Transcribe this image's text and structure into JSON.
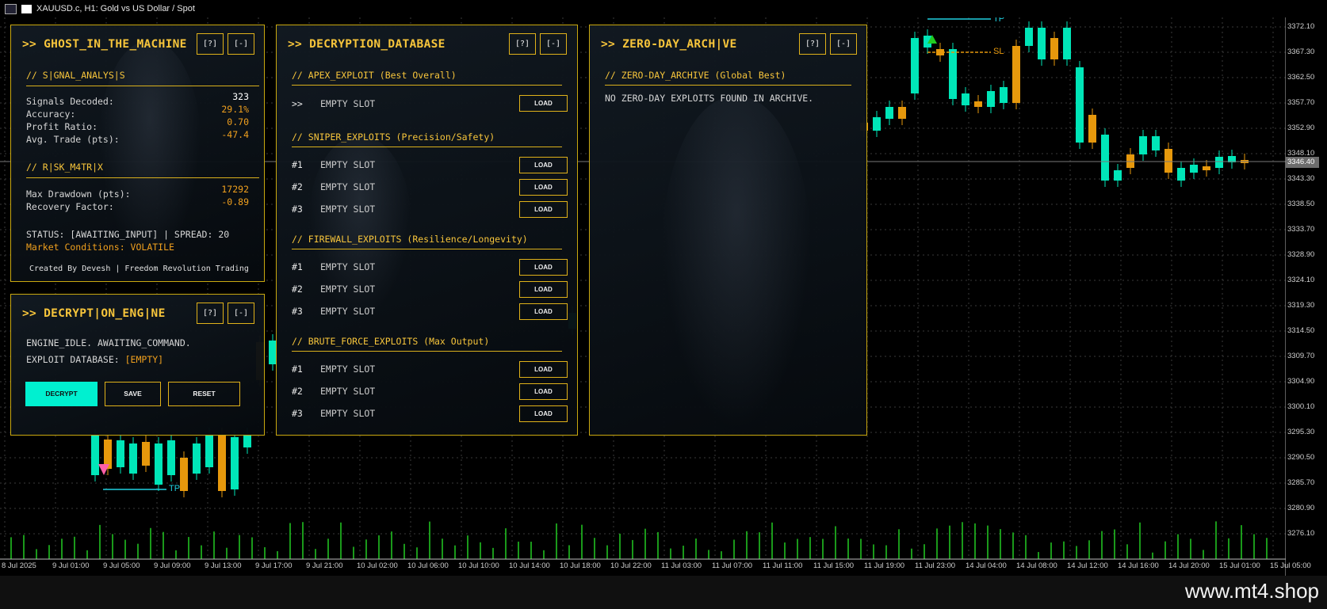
{
  "window": {
    "title": "XAUUSD.c, H1:  Gold vs US Dollar / Spot"
  },
  "chart": {
    "y_axis": [
      "3372.10",
      "3367.30",
      "3362.50",
      "3357.70",
      "3352.90",
      "3348.10",
      "3343.30",
      "3338.50",
      "3333.70",
      "3328.90",
      "3324.10",
      "3319.30",
      "3314.50",
      "3309.70",
      "3304.90",
      "3300.10",
      "3295.30",
      "3290.50",
      "3285.70",
      "3280.90",
      "3276.10"
    ],
    "current_price": "3346.40",
    "x_axis": [
      "8 Jul 2025",
      "9 Jul 01:00",
      "9 Jul 05:00",
      "9 Jul 09:00",
      "9 Jul 13:00",
      "9 Jul 17:00",
      "9 Jul 21:00",
      "10 Jul 02:00",
      "10 Jul 06:00",
      "10 Jul 10:00",
      "10 Jul 14:00",
      "10 Jul 18:00",
      "10 Jul 22:00",
      "11 Jul 03:00",
      "11 Jul 07:00",
      "11 Jul 11:00",
      "11 Jul 15:00",
      "11 Jul 19:00",
      "11 Jul 23:00",
      "14 Jul 04:00",
      "14 Jul 08:00",
      "14 Jul 12:00",
      "14 Jul 16:00",
      "14 Jul 20:00",
      "15 Jul 01:00",
      "15 Jul 05:00"
    ],
    "tp_label": "TP",
    "sl_label": "SL",
    "colors": {
      "bull": "#00e6b8",
      "bear": "#e6980c",
      "volume": "#22cc22",
      "tp": "#20d0e0",
      "sl": "#e6980c"
    }
  },
  "ghost_panel": {
    "title": ">> GHOST_IN_THE_MACHINE",
    "help_btn": "[?]",
    "min_btn": "[-]",
    "signal_title": "// S|GNAL_ANALYS|S",
    "signals_label": "Signals Decoded:",
    "signals_value": "323",
    "accuracy_label": "Accuracy:",
    "accuracy_value": "29.1%",
    "profit_label": "Profit Ratio:",
    "profit_value": "0.70",
    "avg_label": "Avg. Trade (pts):",
    "avg_value": "-47.4",
    "risk_title": "// R|SK_M4TR|X",
    "drawdown_label": "Max Drawdown (pts):",
    "drawdown_value": "17292",
    "recovery_label": "Recovery Factor:",
    "recovery_value": "-0.89",
    "status": "STATUS: [AWAITING_INPUT] | SPREAD: 20",
    "market": "Market Conditions: VOLATILE",
    "credit": "Created By Devesh | Freedom Revolution Trading"
  },
  "engine_panel": {
    "title": ">> DECRYPT|ON_ENG|NE",
    "help_btn": "[?]",
    "min_btn": "[-]",
    "state": "ENGINE_IDLE. AWAITING_COMMAND.",
    "db_label": "EXPLOIT DATABASE: ",
    "db_value": "[EMPTY]",
    "decrypt_btn": "DECRYPT",
    "save_btn": "SAVE",
    "reset_btn": "RESET"
  },
  "db_panel": {
    "title": ">> DECRYPTION_DATABASE",
    "help_btn": "[?]",
    "min_btn": "[-]",
    "apex_title": "// APEX_EXPLOIT (Best Overall)",
    "apex_marker": ">>",
    "sniper_title": "// SNIPER_EXPLOITS (Precision/Safety)",
    "firewall_title": "// FIREWALL_EXPLOITS (Resilience/Longevity)",
    "brute_title": "// BRUTE_FORCE_EXPLOITS (Max Output)",
    "slot_ids": [
      "#1",
      "#2",
      "#3"
    ],
    "empty_slot": "EMPTY SLOT",
    "load_btn": "LOAD"
  },
  "archive_panel": {
    "title": ">> ZER0-DAY_ARCH|VE",
    "help_btn": "[?]",
    "min_btn": "[-]",
    "section_title": "// ZERO-DAY_ARCHIVE (Global Best)",
    "message": "NO ZERO-DAY EXPLOITS FOUND IN ARCHIVE."
  },
  "footer": {
    "watermark": "www.mt4.shop"
  }
}
